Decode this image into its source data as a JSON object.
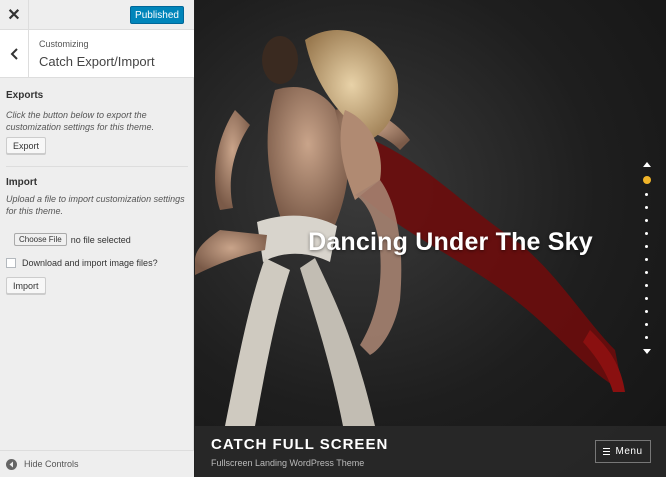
{
  "customizer": {
    "publish_label": "Published",
    "close_icon": "close-icon",
    "breadcrumb": "Customizing",
    "section_title": "Catch Export/Import",
    "exports": {
      "heading": "Exports",
      "description": "Click the button below to export the customization settings for this theme.",
      "button_label": "Export"
    },
    "import": {
      "heading": "Import",
      "description": "Upload a file to import customization settings for this theme.",
      "file_button_label": "Choose File",
      "file_status": "no file selected",
      "checkbox_label": "Download and import image files?",
      "button_label": "Import"
    },
    "hide_controls_label": "Hide Controls"
  },
  "preview": {
    "hero_title": "Dancing Under The Sky",
    "slider": {
      "slide_count": 12,
      "active_index": 0,
      "active_color": "#f0b429"
    },
    "site_title": "CATCH FULL SCREEN",
    "site_tagline": "Fullscreen Landing WordPress Theme",
    "menu_label": "Menu"
  },
  "colors": {
    "accent": "#0085ba",
    "panel_bg": "#eeeeee"
  }
}
